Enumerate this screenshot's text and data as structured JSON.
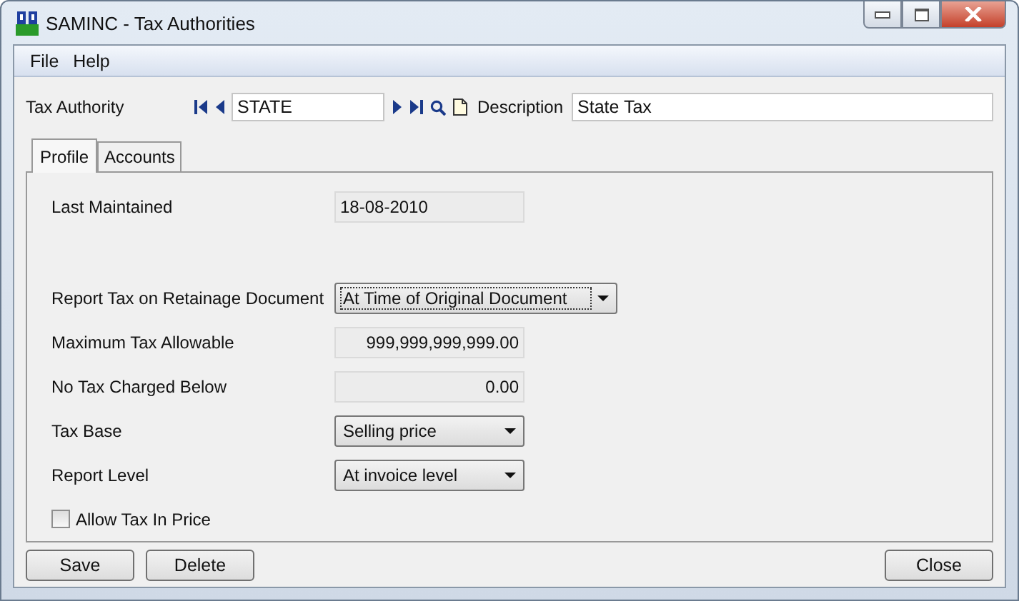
{
  "window": {
    "title": "SAMINC - Tax Authorities"
  },
  "menu": [
    "File",
    "Help"
  ],
  "header": {
    "tax_authority_label": "Tax Authority",
    "tax_authority_value": "STATE",
    "description_label": "Description",
    "description_value": "State Tax"
  },
  "tabs": [
    {
      "label": "Profile",
      "selected": true
    },
    {
      "label": "Accounts",
      "selected": false
    }
  ],
  "fields": [
    {
      "kind": "readonly",
      "label": "Last Maintained",
      "value": "18-08-2010"
    },
    {
      "kind": "dropdown",
      "label": "Report Tax on Retainage Document",
      "value": "At Time of Original Document",
      "wide": true,
      "focused": true
    },
    {
      "kind": "amount",
      "label": "Maximum Tax Allowable",
      "value": "999,999,999,999.00"
    },
    {
      "kind": "amount",
      "label": "No Tax Charged Below",
      "value": "0.00"
    },
    {
      "kind": "dropdown",
      "label": "Tax Base",
      "value": "Selling price",
      "wide": false,
      "focused": false
    },
    {
      "kind": "dropdown",
      "label": "Report Level",
      "value": "At invoice level",
      "wide": false,
      "focused": false
    },
    {
      "kind": "checkbox",
      "label": "Allow Tax In Price",
      "checked": false
    }
  ],
  "buttons_left": [
    "Save",
    "Delete"
  ],
  "buttons_right": [
    "Close"
  ]
}
